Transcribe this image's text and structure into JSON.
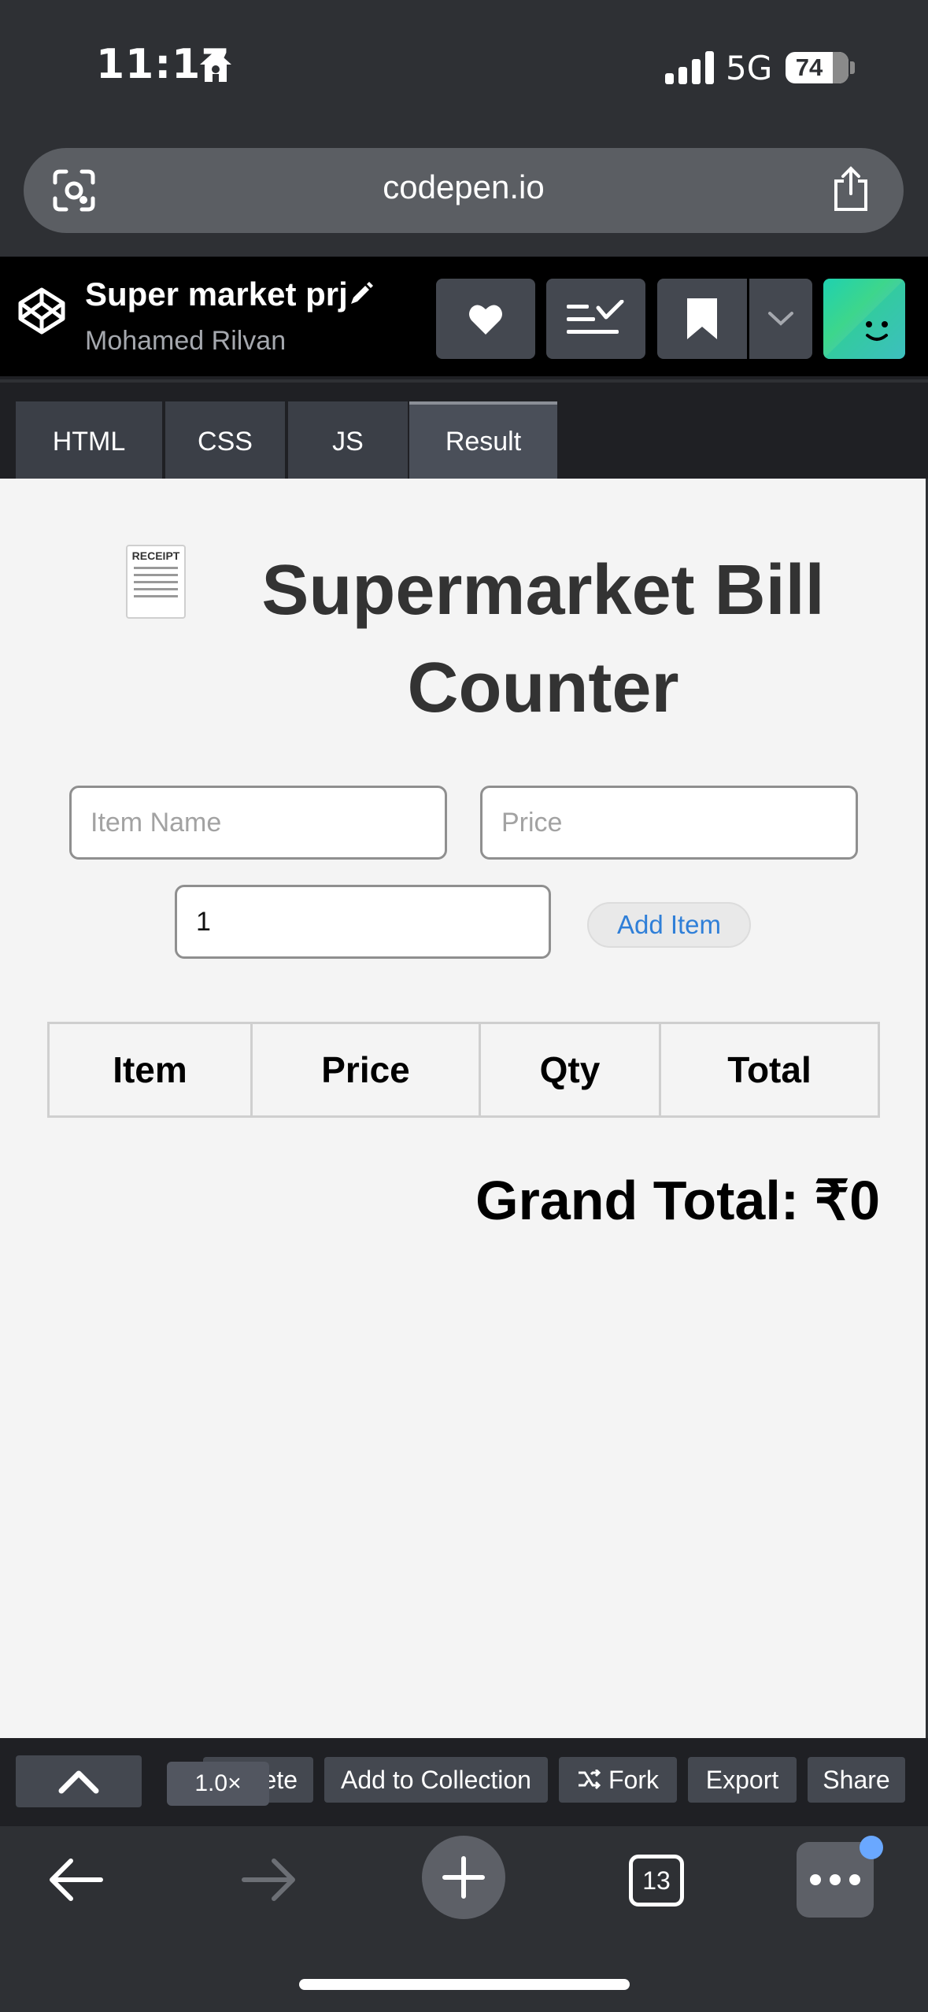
{
  "status_bar": {
    "time": "11:17",
    "network": "5G",
    "battery": "74"
  },
  "browser": {
    "url": "codepen.io"
  },
  "pen": {
    "title": "Super market prj",
    "author": "Mohamed Rilvan"
  },
  "tabs": [
    {
      "label": "HTML"
    },
    {
      "label": "CSS"
    },
    {
      "label": "JS"
    },
    {
      "label": "Result"
    }
  ],
  "app": {
    "emoji_label": "RECEIPT",
    "title": "Supermarket Bill Counter",
    "inputs": {
      "item_placeholder": "Item Name",
      "price_placeholder": "Price",
      "qty_value": "1"
    },
    "add_button": "Add Item",
    "table_headers": [
      "Item",
      "Price",
      "Qty",
      "Total"
    ],
    "grand_total": "Grand Total: ₹0"
  },
  "toolbar": {
    "zoom": "1.0×",
    "delete_partial": "ete",
    "add_to_collection": "Add to Collection",
    "fork": "Fork",
    "export": "Export",
    "share": "Share"
  },
  "nav": {
    "tab_count": "13"
  }
}
